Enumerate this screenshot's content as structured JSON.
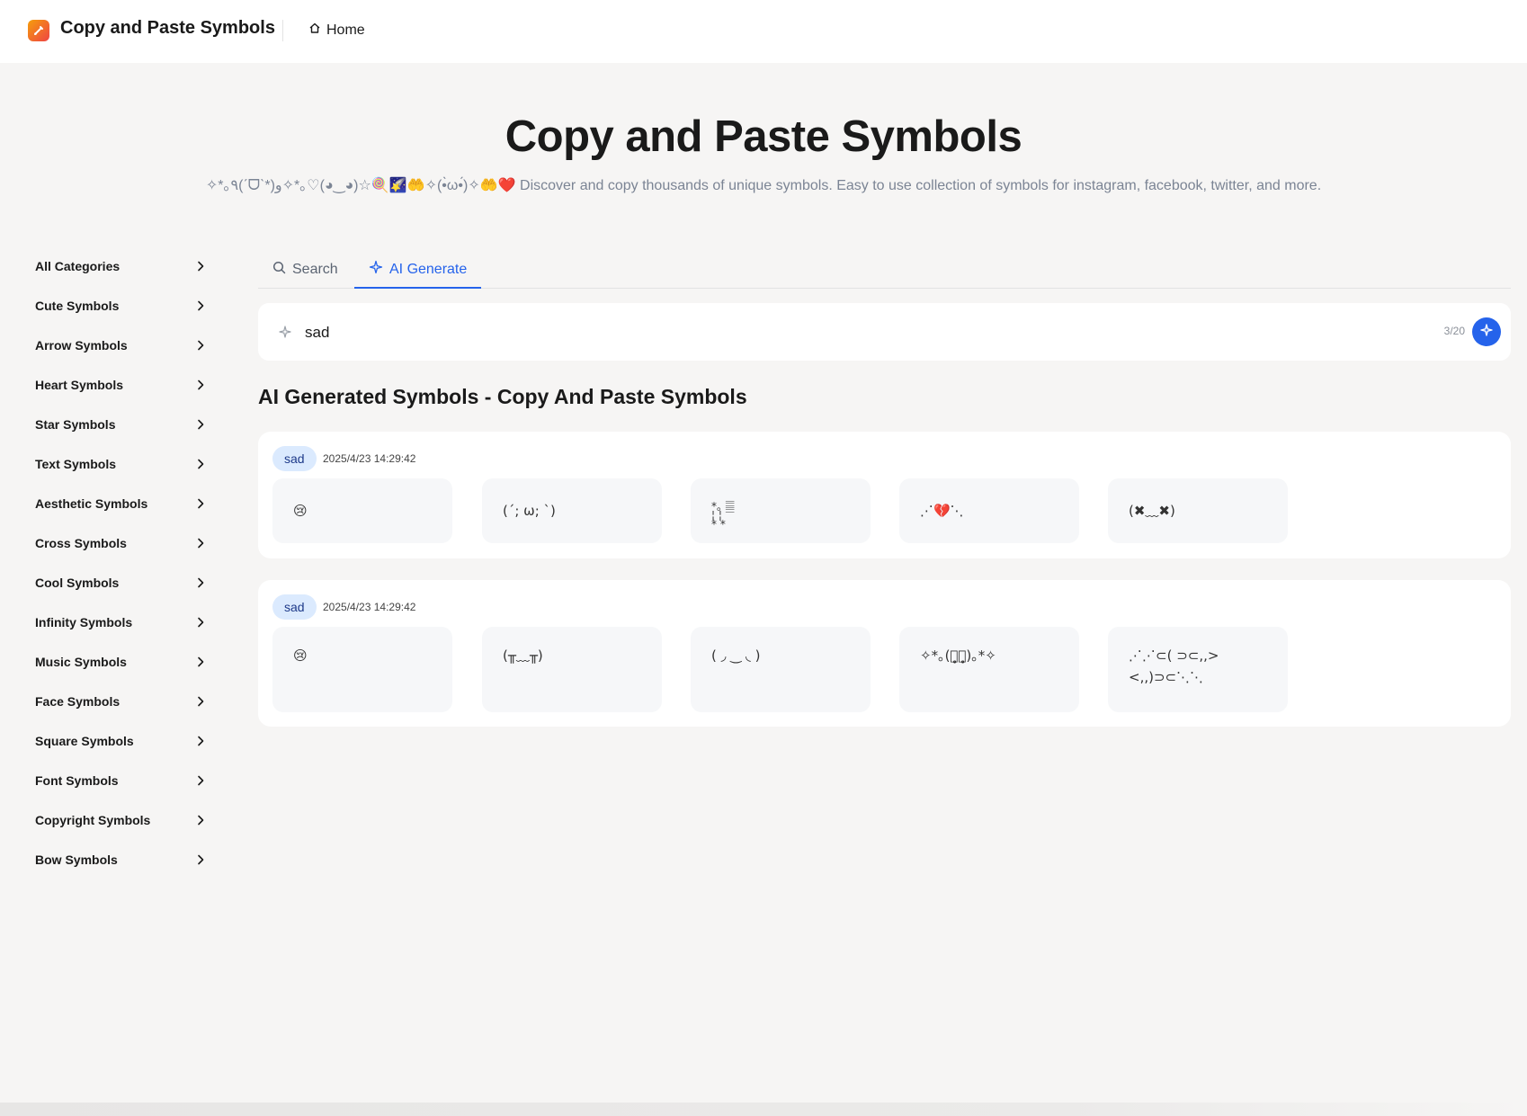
{
  "header": {
    "site_title": "Copy and Paste Symbols",
    "home_label": "Home"
  },
  "hero": {
    "title": "Copy and Paste Symbols",
    "subtitle": "✧*｡٩(ˊᗜˋ*)و✧*｡♡(◕‿◕)☆🍭🌠🤲✧(•̀ω•́)✧🤲❤️ Discover and copy thousands of unique symbols. Easy to use collection of symbols for instagram, facebook, twitter, and more."
  },
  "sidebar": {
    "items": [
      {
        "label": "All Categories"
      },
      {
        "label": "Cute Symbols"
      },
      {
        "label": "Arrow Symbols"
      },
      {
        "label": "Heart Symbols"
      },
      {
        "label": "Star Symbols"
      },
      {
        "label": "Text Symbols"
      },
      {
        "label": "Aesthetic Symbols"
      },
      {
        "label": "Cross Symbols"
      },
      {
        "label": "Cool Symbols"
      },
      {
        "label": "Infinity Symbols"
      },
      {
        "label": "Music Symbols"
      },
      {
        "label": "Face Symbols"
      },
      {
        "label": "Square Symbols"
      },
      {
        "label": "Font Symbols"
      },
      {
        "label": "Copyright Symbols"
      },
      {
        "label": "Bow Symbols"
      }
    ]
  },
  "tabs": {
    "search_label": "Search",
    "ai_label": "AI Generate",
    "active": "AI Generate"
  },
  "prompt": {
    "value": "sad",
    "counter": "3/20"
  },
  "results_title": "AI Generated Symbols - Copy And Paste Symbols",
  "results": [
    {
      "tag": "sad",
      "timestamp": "2025/4/23 14:29:42",
      "symbols": [
        "😢",
        "(´; ω; `)",
        "*｡ 𝄛\n¦ ¦\n* *",
        "⋰💔⋱",
        "(✖﹏✖)"
      ]
    },
    {
      "tag": "sad",
      "timestamp": "2025/4/23 14:29:42",
      "symbols": [
        "😢",
        "(╥﹏╥)",
        "( ◞ ‿ ◟ )",
        "✧*｡(ㅠ̥̥ㅠ̥̥)｡*✧",
        "⋰⋰⊂( ⊃⊂,,>\n<,,)⊃⊂⋱⋱"
      ]
    }
  ],
  "colors": {
    "accent": "#2563eb",
    "tag_bg": "#dbeafe",
    "page_bg": "#f6f5f4",
    "card_bg": "#ffffff"
  },
  "icons": {
    "logo": "pencil-logo-icon",
    "home": "home-icon",
    "search": "search-icon",
    "ai": "sparkle-icon",
    "chevron": "chevron-right-icon"
  }
}
